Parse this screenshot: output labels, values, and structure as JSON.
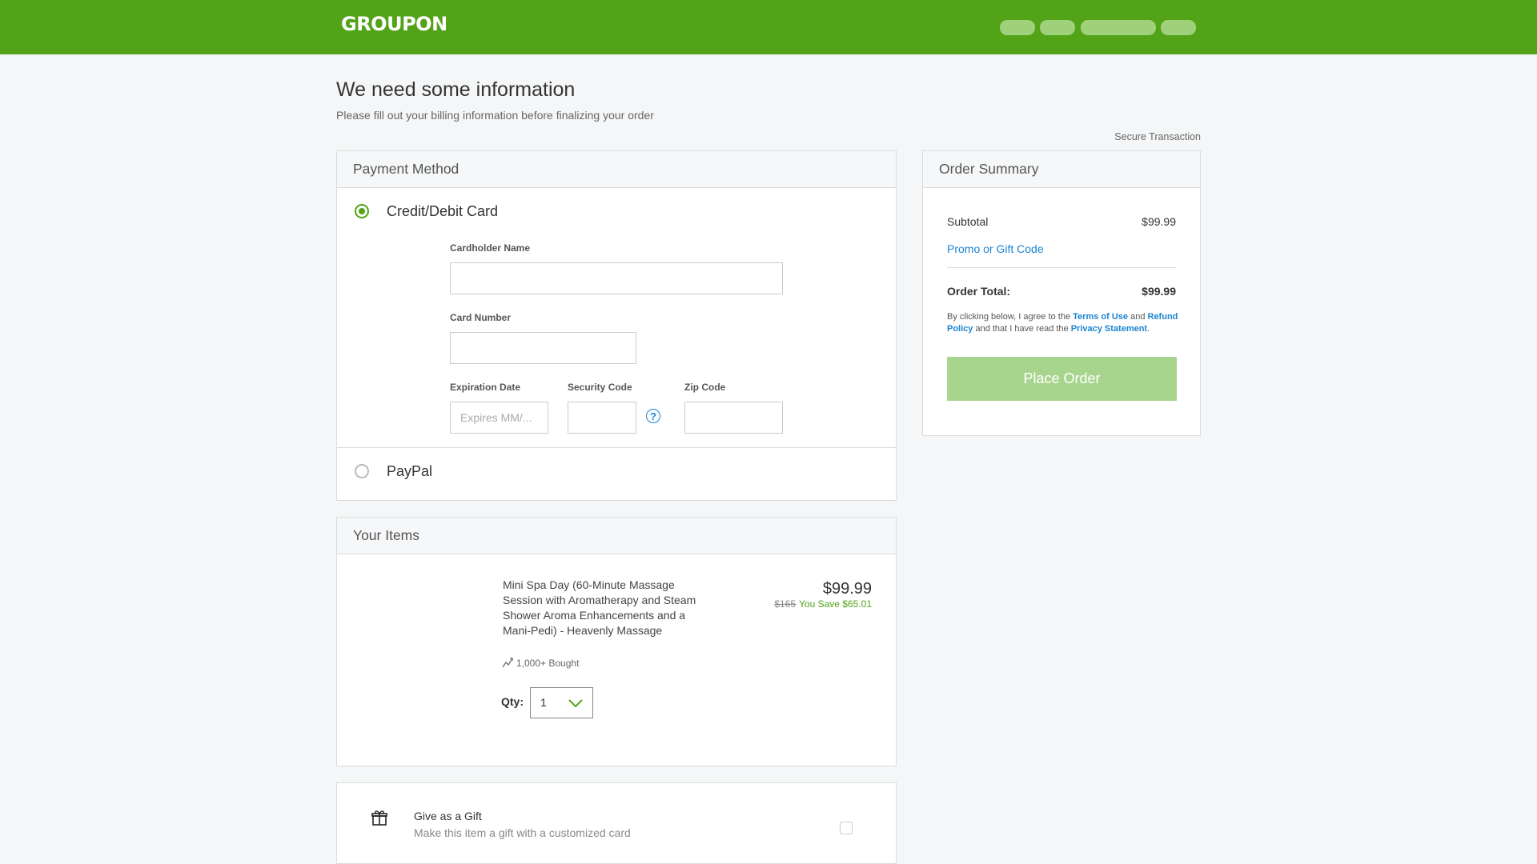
{
  "header": {
    "logo": "GROUPON",
    "nav_pills": [
      "",
      "",
      "",
      ""
    ]
  },
  "page": {
    "title": "We need some information",
    "subtitle": "Please fill out your billing information before finalizing your order",
    "secure_label": "Secure Transaction"
  },
  "payment": {
    "heading": "Payment Method",
    "card_option": {
      "label": "Credit/Debit Card",
      "selected": true
    },
    "fields": {
      "cardholder_label": "Cardholder Name",
      "cardholder_value": "",
      "card_number_label": "Card Number",
      "card_number_value": "",
      "expiration_label": "Expiration Date",
      "expiration_placeholder": "Expires MM/...",
      "security_label": "Security Code",
      "security_value": "",
      "zip_label": "Zip Code",
      "zip_value": "",
      "help_glyph": "?"
    },
    "paypal_option": {
      "label": "PayPal",
      "selected": false
    }
  },
  "summary": {
    "heading": "Order Summary",
    "subtotal_label": "Subtotal",
    "subtotal_value": "$99.99",
    "promo_link": "Promo or Gift Code",
    "total_label": "Order Total:",
    "total_value": "$99.99",
    "legal": {
      "t1": "By clicking below, I agree to the ",
      "terms": "Terms of Use",
      "t2": " and ",
      "refund": "Refund Policy",
      "t3": " and that I have read the ",
      "privacy": "Privacy Statement",
      "t4": "."
    },
    "place_order": "Place Order"
  },
  "items": {
    "heading": "Your Items",
    "list": [
      {
        "title": "Mini Spa Day (60-Minute Massage Session with Aromatherapy and Steam Shower Aroma Enhancements and a Mani-Pedi) - Heavenly Massage",
        "price": "$99.99",
        "original_price": "$165",
        "savings": "You Save $65.01",
        "bought": "1,000+ Bought",
        "qty_label": "Qty:",
        "qty_value": "1"
      }
    ]
  },
  "gift": {
    "title": "Give as a Gift",
    "subtitle": "Make this item a gift with a customized card",
    "checked": false
  },
  "colors": {
    "brand_green": "#53a318",
    "link_blue": "#1a84d1",
    "button_disabled_green": "#a8d58e"
  },
  "icons": [
    "gift-icon",
    "trending-icon",
    "chevron-down-icon",
    "help-icon"
  ]
}
